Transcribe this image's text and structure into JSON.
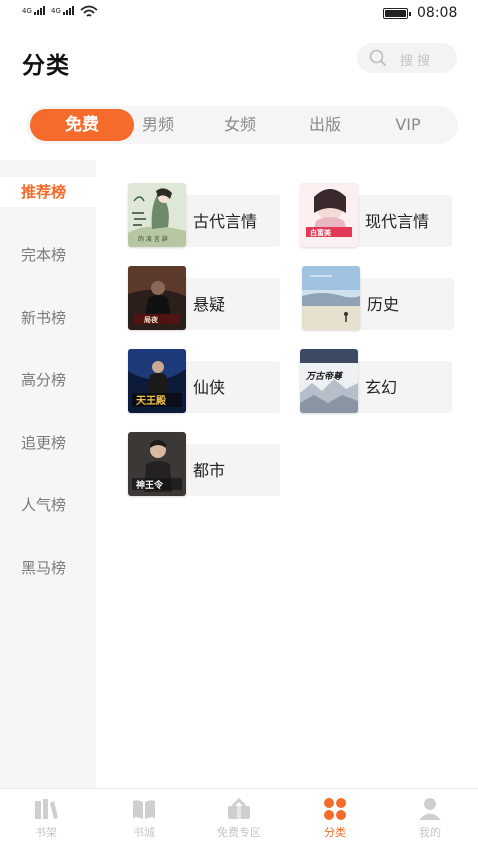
{
  "status_bar": {
    "time": "08:08",
    "signal_badge": "4G"
  },
  "header": {
    "title": "分类",
    "search_placeholder": "搜 搜"
  },
  "tabs": [
    {
      "label": "免费",
      "active": true
    },
    {
      "label": "男频",
      "active": false
    },
    {
      "label": "女频",
      "active": false
    },
    {
      "label": "出版",
      "active": false
    },
    {
      "label": "VIP",
      "active": false
    }
  ],
  "sidebar": {
    "items": [
      {
        "label": "推荐榜",
        "active": true
      },
      {
        "label": "完本榜",
        "active": false
      },
      {
        "label": "新书榜",
        "active": false
      },
      {
        "label": "高分榜",
        "active": false
      },
      {
        "label": "追更榜",
        "active": false
      },
      {
        "label": "人气榜",
        "active": false
      },
      {
        "label": "黑马榜",
        "active": false
      }
    ]
  },
  "categories": [
    {
      "name": "古代言情",
      "cover_title": "的 凌 言 辞"
    },
    {
      "name": "现代言情",
      "cover_title": "白富美"
    },
    {
      "name": "悬疑",
      "cover_title": "局夜"
    },
    {
      "name": "历史",
      "cover_title": ""
    },
    {
      "name": "仙侠",
      "cover_title": "天王殿"
    },
    {
      "name": "玄幻",
      "cover_title": "万古帝尊"
    },
    {
      "name": "都市",
      "cover_title": "神王令"
    }
  ],
  "bottom_nav": [
    {
      "label": "书架",
      "icon": "bookshelf-icon",
      "active": false
    },
    {
      "label": "书城",
      "icon": "book-icon",
      "active": false
    },
    {
      "label": "免费专区",
      "icon": "gift-icon",
      "active": false
    },
    {
      "label": "分类",
      "icon": "grid-icon",
      "active": true
    },
    {
      "label": "我的",
      "icon": "person-icon",
      "active": false
    }
  ],
  "colors": {
    "accent": "#f46b2b",
    "sidebar_bg": "#f6f6f6",
    "inactive_text": "#8a8a8a"
  }
}
